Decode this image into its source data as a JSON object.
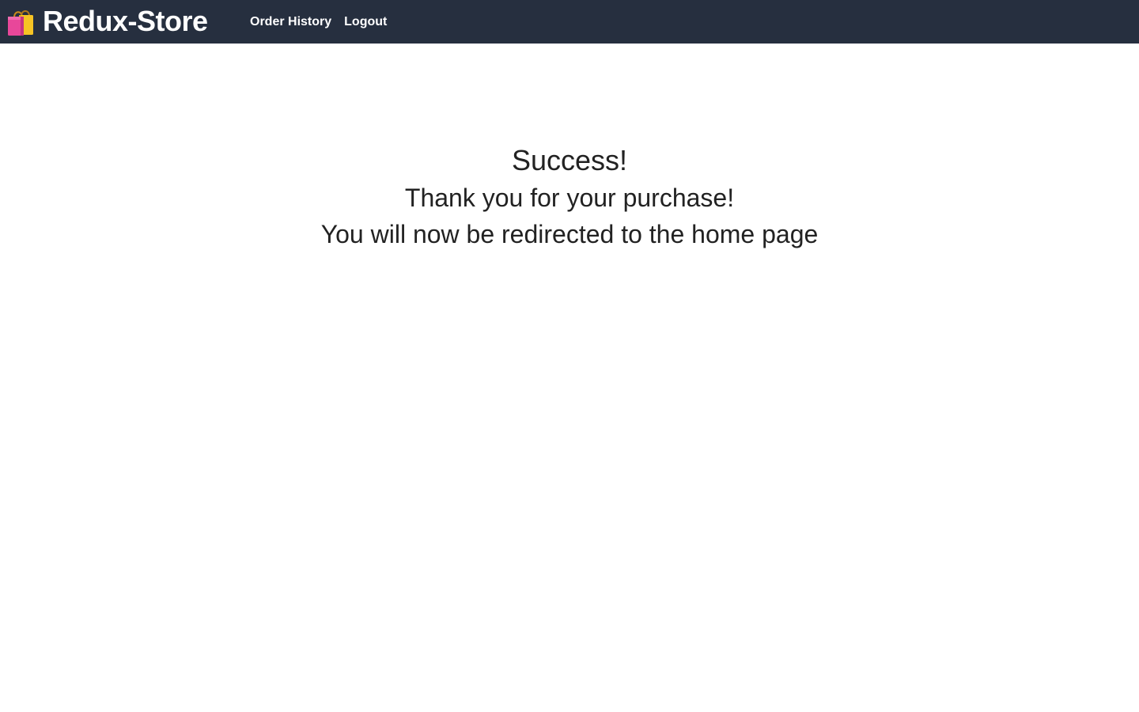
{
  "header": {
    "brand_icon": "shopping-bags-icon",
    "brand_title": "Redux-Store",
    "nav": [
      {
        "label": "Order History"
      },
      {
        "label": "Logout"
      }
    ],
    "background_color": "#262f3f"
  },
  "main": {
    "heading": "Success!",
    "thanks": "Thank you for your purchase!",
    "redirect": "You will now be redirected to the home page"
  }
}
